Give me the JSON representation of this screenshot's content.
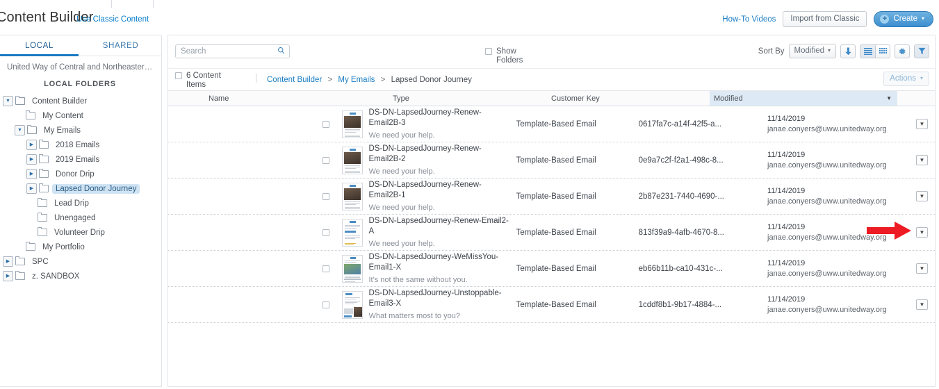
{
  "header": {
    "title": "Content Builder",
    "classic_link": "Use Classic Content",
    "howto_link": "How-To Videos",
    "import_button": "Import from Classic",
    "create_button": "Create",
    "create_plus": "+"
  },
  "sidebar": {
    "tabs": [
      {
        "label": "LOCAL",
        "active": true
      },
      {
        "label": "SHARED",
        "active": false
      }
    ],
    "account_name": "United Way of Central and Northeastern Con...",
    "section_title": "LOCAL FOLDERS",
    "tree": [
      {
        "label": "Content Builder",
        "depth": 0,
        "twist": "expanded",
        "selected": false
      },
      {
        "label": "My Content",
        "depth": 1,
        "twist": "none",
        "selected": false
      },
      {
        "label": "My Emails",
        "depth": 1,
        "twist": "expanded",
        "selected": false
      },
      {
        "label": "2018 Emails",
        "depth": 2,
        "twist": "collapsed",
        "selected": false
      },
      {
        "label": "2019 Emails",
        "depth": 2,
        "twist": "collapsed",
        "selected": false
      },
      {
        "label": "Donor Drip",
        "depth": 2,
        "twist": "collapsed",
        "selected": false
      },
      {
        "label": "Lapsed Donor Journey",
        "depth": 2,
        "twist": "collapsed",
        "selected": true
      },
      {
        "label": "Lead Drip",
        "depth": 2,
        "twist": "none",
        "selected": false
      },
      {
        "label": "Unengaged",
        "depth": 2,
        "twist": "none",
        "selected": false
      },
      {
        "label": "Volunteer Drip",
        "depth": 2,
        "twist": "none",
        "selected": false
      },
      {
        "label": "My Portfolio",
        "depth": 1,
        "twist": "none",
        "selected": false
      },
      {
        "label": "SPC",
        "depth": 0,
        "twist": "collapsed",
        "selected": false
      },
      {
        "label": "z. SANDBOX",
        "depth": 0,
        "twist": "collapsed",
        "selected": false
      }
    ]
  },
  "toolbar": {
    "search_placeholder": "Search",
    "search_value": "",
    "show_folders_label": "Show Folders",
    "show_folders_checked": false,
    "sort_by_label": "Sort By",
    "sort_by_value": "Modified",
    "sort_direction_icon": "arrow-down-icon",
    "view_list_icon": "list-view-icon",
    "view_grid_icon": "grid-view-icon",
    "settings_icon": "gear-icon",
    "filter_icon": "filter-icon"
  },
  "breadcrumb": {
    "count_label": "6 Content Items",
    "count_checked": false,
    "path": [
      {
        "label": "Content Builder",
        "link": true
      },
      {
        "label": "My Emails",
        "link": true
      },
      {
        "label": "Lapsed Donor Journey",
        "link": false
      }
    ],
    "separator": ">",
    "actions_button": "Actions"
  },
  "table": {
    "columns": [
      "Name",
      "Type",
      "Customer Key",
      "Modified"
    ],
    "sorted_column": "Modified",
    "sort_caret": "▼",
    "rows": [
      {
        "name": "DS-DN-LapsedJourney-Renew-Email2B-3",
        "subject": "We need your help.",
        "type": "Template-Based Email",
        "customer_key": "0617fa7c-a14f-42f5-a...",
        "modified_date": "11/14/2019",
        "modified_by": "janae.conyers@uww.unitedway.org",
        "thumb": "donor",
        "checked": false
      },
      {
        "name": "DS-DN-LapsedJourney-Renew-Email2B-2",
        "subject": "We need your help.",
        "type": "Template-Based Email",
        "customer_key": "0e9a7c2f-f2a1-498c-8...",
        "modified_date": "11/14/2019",
        "modified_by": "janae.conyers@uww.unitedway.org",
        "thumb": "donor",
        "checked": false
      },
      {
        "name": "DS-DN-LapsedJourney-Renew-Email2B-1",
        "subject": "We need your help.",
        "type": "Template-Based Email",
        "customer_key": "2b87e231-7440-4690-...",
        "modified_date": "11/14/2019",
        "modified_by": "janae.conyers@uww.unitedway.org",
        "thumb": "donor",
        "checked": false
      },
      {
        "name": "DS-DN-LapsedJourney-Renew-Email2-A",
        "subject": "We need your help.",
        "type": "Template-Based Email",
        "customer_key": "813f39a9-4afb-4670-8...",
        "modified_date": "11/14/2019",
        "modified_by": "janae.conyers@uww.unitedway.org",
        "thumb": "text",
        "checked": false,
        "highlighted": true
      },
      {
        "name": "DS-DN-LapsedJourney-WeMissYou-Email1-X",
        "subject": "It's not the same without you.",
        "type": "Template-Based Email",
        "customer_key": "eb66b11b-ca10-431c-...",
        "modified_date": "11/14/2019",
        "modified_by": "janae.conyers@uww.unitedway.org",
        "thumb": "people",
        "checked": false
      },
      {
        "name": "DS-DN-LapsedJourney-Unstoppable-Email3-X",
        "subject": "What matters most to you?",
        "type": "Template-Based Email",
        "customer_key": "1cddf8b1-9b17-4884-...",
        "modified_date": "11/14/2019",
        "modified_by": "janae.conyers@uww.unitedway.org",
        "thumb": "mixed",
        "checked": false
      }
    ],
    "row_menu_icon": "chevron-down-icon"
  },
  "annotation": {
    "arrow_color": "#ed1c24",
    "arrow_target": "row-4-menu-button"
  },
  "colors": {
    "link": "#1b7ec4",
    "accent": "#1979c3",
    "selected_tree": "#cfe3f3",
    "sorted_header": "#ddeaf5"
  }
}
